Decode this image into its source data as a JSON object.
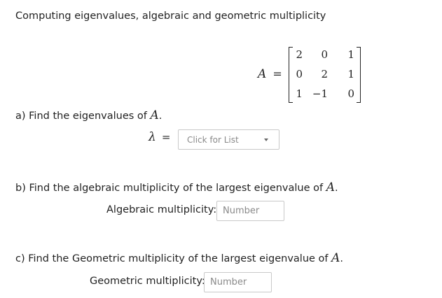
{
  "problem": {
    "title": "Computing eigenvalues, algebraic and geometric multiplicity",
    "matrix_symbol": "A",
    "matrix_equals": "=",
    "matrix": [
      [
        "2",
        "0",
        "1"
      ],
      [
        "0",
        "2",
        "1"
      ],
      [
        "1",
        "−1",
        "0"
      ]
    ]
  },
  "part_a": {
    "question_text": "a) Find the eigenvalues of",
    "question_symbol": "A",
    "question_end": ".",
    "lambda_symbol": "λ",
    "equals": "=",
    "select_placeholder": "Click for List"
  },
  "part_b": {
    "question_text": "b) Find the algebraic multiplicity of the largest eigenvalue of",
    "question_symbol": "A",
    "question_end": ".",
    "label": "Algebraic multiplicity:",
    "input_placeholder": "Number"
  },
  "part_c": {
    "question_text": "c) Find the Geometric multiplicity of the largest eigenvalue of",
    "question_symbol": "A",
    "question_end": ".",
    "label": "Geometric multiplicity:",
    "input_placeholder": "Number"
  }
}
